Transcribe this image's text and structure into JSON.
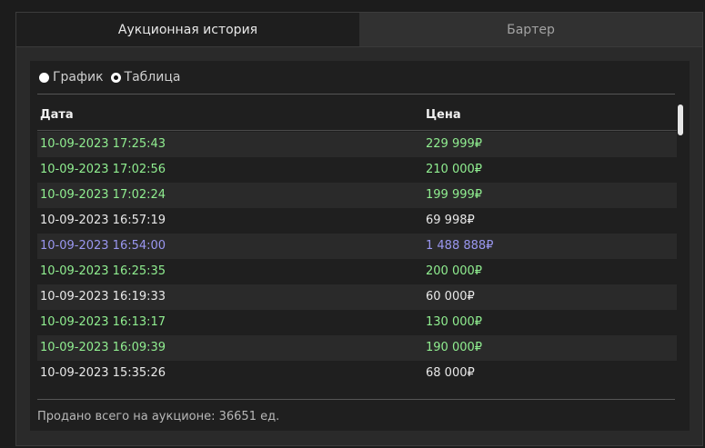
{
  "tabs": [
    {
      "label": "Аукционная история",
      "active": true
    },
    {
      "label": "Бартер",
      "active": false
    }
  ],
  "view_options": [
    {
      "label": "График",
      "checked": false
    },
    {
      "label": "Таблица",
      "checked": true
    }
  ],
  "table": {
    "columns": [
      "Дата",
      "Цена"
    ],
    "rows": [
      {
        "date": "10-09-2023 17:25:43",
        "price": "229 999₽",
        "color": "green"
      },
      {
        "date": "10-09-2023 17:02:56",
        "price": "210 000₽",
        "color": "green"
      },
      {
        "date": "10-09-2023 17:02:24",
        "price": "199 999₽",
        "color": "green"
      },
      {
        "date": "10-09-2023 16:57:19",
        "price": "69 998₽",
        "color": "white"
      },
      {
        "date": "10-09-2023 16:54:00",
        "price": "1 488 888₽",
        "color": "purple"
      },
      {
        "date": "10-09-2023 16:25:35",
        "price": "200 000₽",
        "color": "green"
      },
      {
        "date": "10-09-2023 16:19:33",
        "price": "60 000₽",
        "color": "white"
      },
      {
        "date": "10-09-2023 16:13:17",
        "price": "130 000₽",
        "color": "green"
      },
      {
        "date": "10-09-2023 16:09:39",
        "price": "190 000₽",
        "color": "green"
      },
      {
        "date": "10-09-2023 15:35:26",
        "price": "68 000₽",
        "color": "white"
      }
    ]
  },
  "footer": {
    "text": "Продано всего на аукционе: 36651 ед."
  },
  "colors": {
    "green": "#90ee90",
    "white": "#e8e8e8",
    "purple": "#9a97f0"
  }
}
